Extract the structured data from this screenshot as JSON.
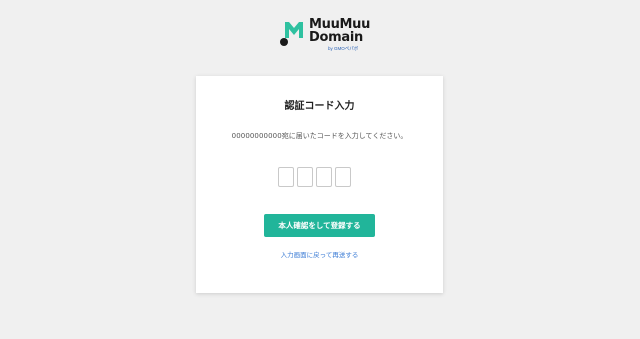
{
  "logo": {
    "line1": "MuuMuu",
    "line2": "Domain",
    "sub": "by GMOペパボ",
    "colors": {
      "mark_green": "#2fc1a0",
      "mark_dark": "#1a1a1a",
      "sub_blue": "#2a62b5"
    }
  },
  "card": {
    "title": "認証コード入力",
    "message_phone": "00000000000",
    "message_rest": "宛に届いたコードを入力してください。",
    "code_digits": [
      "",
      "",
      "",
      ""
    ],
    "submit_label": "本人確認をして登録する",
    "resend_label": "入力画面に戻って再送する"
  },
  "colors": {
    "background": "#f0f0f0",
    "accent": "#21b59a",
    "link": "#3a7bd5"
  }
}
